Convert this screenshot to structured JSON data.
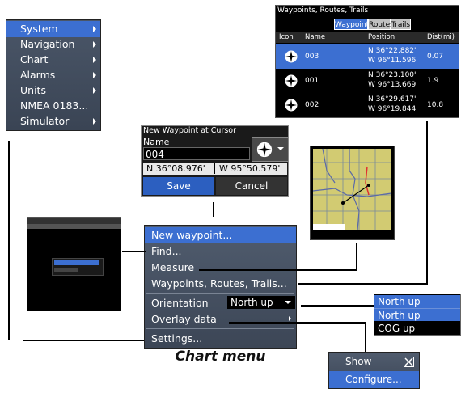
{
  "system_menu": {
    "items": [
      {
        "label": "System",
        "submenu": true,
        "selected": true
      },
      {
        "label": "Navigation",
        "submenu": true
      },
      {
        "label": "Chart",
        "submenu": true
      },
      {
        "label": "Alarms",
        "submenu": true
      },
      {
        "label": "Units",
        "submenu": true
      },
      {
        "label": "NMEA 0183...",
        "submenu": false
      },
      {
        "label": "Simulator",
        "submenu": true
      }
    ]
  },
  "wrt_panel": {
    "title": "Waypoints, Routes, Trails",
    "tabs": [
      "Waypoints",
      "Routes",
      "Trails"
    ],
    "active_tab": "Waypoints",
    "columns": [
      "Icon",
      "Name",
      "Position",
      "Dist(mi)"
    ],
    "rows": [
      {
        "name": "003",
        "lat": "N  36°22.882'",
        "lon": "W  96°11.596'",
        "dist": "0.07",
        "selected": true
      },
      {
        "name": "001",
        "lat": "N  36°23.100'",
        "lon": "W  96°13.669'",
        "dist": "1.9",
        "selected": false
      },
      {
        "name": "002",
        "lat": "N  36°29.617'",
        "lon": "W  96°19.844'",
        "dist": "10.8",
        "selected": false
      }
    ]
  },
  "new_waypoint_dialog": {
    "title": "New Waypoint at Cursor",
    "name_label": "Name",
    "name_value": "004",
    "latitude": "N  36°08.976'",
    "longitude": "W  95°50.579'",
    "save_label": "Save",
    "cancel_label": "Cancel"
  },
  "chart_menu": {
    "items": {
      "new_waypoint": "New waypoint...",
      "find": "Find...",
      "measure": "Measure",
      "waypoints_routes_trails": "Waypoints, Routes, Trails...",
      "orientation": "Orientation",
      "orientation_value": "North up",
      "overlay_data": "Overlay data",
      "settings": "Settings..."
    },
    "caption": "Chart menu"
  },
  "orientation_dropdown": {
    "current": "North up",
    "options": [
      "North up",
      "COG up"
    ]
  },
  "overlay_submenu": {
    "show_label": "Show",
    "configure_label": "Configure..."
  },
  "colors": {
    "selection": "#3c6fd1",
    "menu_bg": "#46505f",
    "panel_bg": "#000000"
  }
}
